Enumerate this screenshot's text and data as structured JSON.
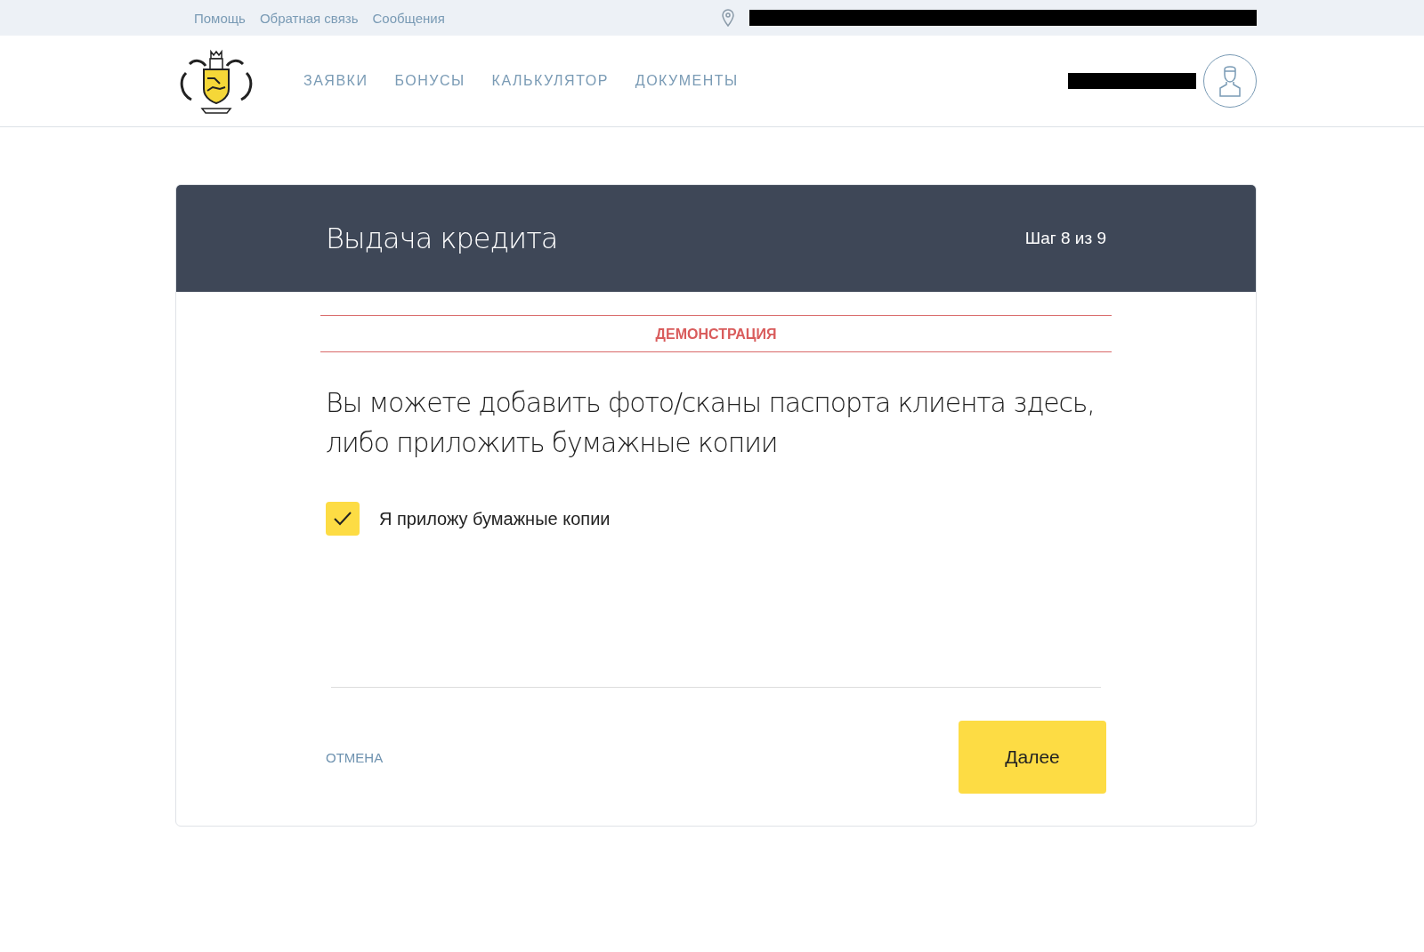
{
  "top_links": [
    "Помощь",
    "Обратная связь",
    "Сообщения"
  ],
  "nav": [
    {
      "label": "ЗАЯВКИ",
      "selected": false
    },
    {
      "label": "БОНУСЫ",
      "selected": false
    },
    {
      "label": "КАЛЬКУЛЯТОР",
      "selected": false
    },
    {
      "label": "ДОКУМЕНТЫ",
      "selected": false
    }
  ],
  "card": {
    "title": "Выдача кредита",
    "step": "Шаг 8 из 9",
    "demo_label": "ДЕМОНСТРАЦИЯ",
    "message": "Вы можете добавить фото/сканы паспорта клиента здесь, либо приложить бумажные копии",
    "checkbox": {
      "label": "Я приложу бумажные копии",
      "checked": true
    },
    "cancel": "ОТМЕНА",
    "next": "Далее"
  }
}
